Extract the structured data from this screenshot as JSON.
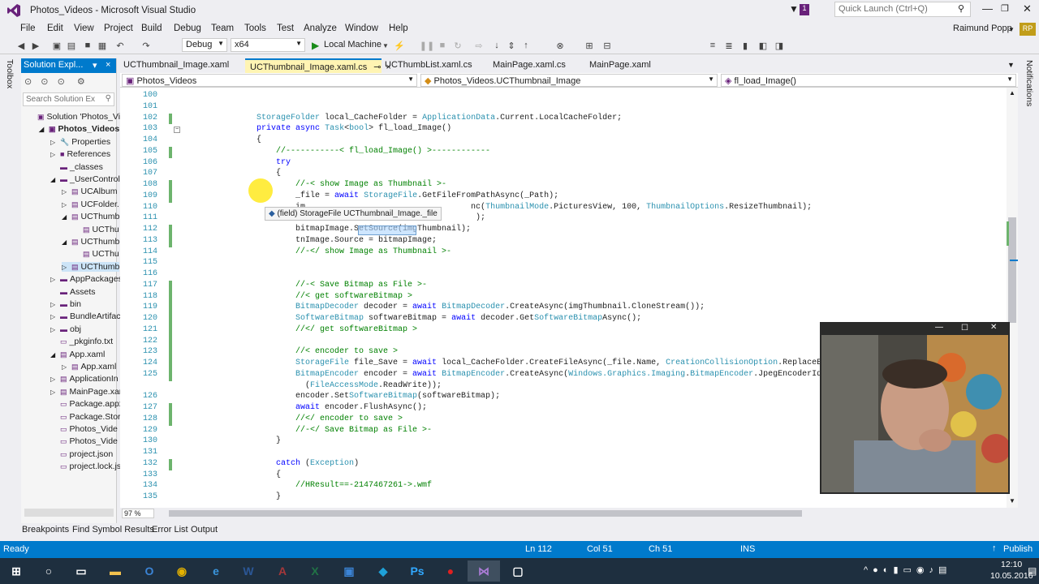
{
  "window": {
    "title": "Photos_Videos - Microsoft Visual Studio",
    "quick_launch": "Quick Launch (Ctrl+Q)",
    "user": "Raimund Popp",
    "user_initials": "RP",
    "notif_count": "1"
  },
  "menu": [
    "File",
    "Edit",
    "View",
    "Project",
    "Build",
    "Debug",
    "Team",
    "Tools",
    "Test",
    "Analyze",
    "Window",
    "Help"
  ],
  "toolbar": {
    "config": "Debug",
    "platform": "x64",
    "run_label": "Local Machine"
  },
  "solution_explorer": {
    "title": "Solution Expl...",
    "search_placeholder": "Search Solution Ex",
    "items": [
      "Solution 'Photos_Vid",
      "Photos_Videos",
      "Properties",
      "References",
      "_classes",
      "_UserControls",
      "UCAlbum",
      "UCFolder.",
      "UCThumb",
      "UCThu",
      "UCThumb",
      "UCThu",
      "UCThumb",
      "AppPackages",
      "Assets",
      "bin",
      "BundleArtifac",
      "obj",
      "_pkginfo.txt",
      "App.xaml",
      "App.xaml",
      "ApplicationIn",
      "MainPage.xar",
      "Package.appx",
      "Package.Store",
      "Photos_Vide",
      "Photos_Vide",
      "project.json",
      "project.lock.js"
    ],
    "zoom": "97 %"
  },
  "tabs": [
    "UCThumbnail_Image.xaml",
    "UCThumbnail_Image.xaml.cs",
    "UCThumbList.xaml.cs",
    "MainPage.xaml.cs",
    "MainPage.xaml"
  ],
  "navbar": {
    "project": "Photos_Videos",
    "class": "Photos_Videos.UCThumbnail_Image",
    "member": "fl_load_Image()"
  },
  "code_lines": [
    {
      "n": "100",
      "t": ""
    },
    {
      "n": "101",
      "t": ""
    },
    {
      "n": "102",
      "t": "        StorageFolder local_CacheFolder = ApplicationData.Current.LocalCacheFolder;"
    },
    {
      "n": "103",
      "t": "        private async Task<bool> fl_load_Image()"
    },
    {
      "n": "104",
      "t": "        {"
    },
    {
      "n": "105",
      "t": "            //-----------< fl_load_Image() >------------"
    },
    {
      "n": "106",
      "t": "            try"
    },
    {
      "n": "107",
      "t": "            {"
    },
    {
      "n": "108",
      "t": "                //-< show Image as Thumbnail >-"
    },
    {
      "n": "109",
      "t": "                _file = await StorageFile.GetFileFromPathAsync(_Path);"
    },
    {
      "n": "110",
      "t": "                im                                  nc(ThumbnailMode.PicturesView, 100, ThumbnailOptions.ResizeThumbnail);"
    },
    {
      "n": "111",
      "t": "                Bi                                   );"
    },
    {
      "n": "112",
      "t": "                bitmapImage.SetSource(imgThumbnail);"
    },
    {
      "n": "113",
      "t": "                tnImage.Source = bitmapImage;"
    },
    {
      "n": "114",
      "t": "                //-</ show Image as Thumbnail >-"
    },
    {
      "n": "115",
      "t": ""
    },
    {
      "n": "116",
      "t": ""
    },
    {
      "n": "117",
      "t": "                //-< Save Bitmap as File >-"
    },
    {
      "n": "118",
      "t": "                //< get softwareBitmap >"
    },
    {
      "n": "119",
      "t": "                BitmapDecoder decoder = await BitmapDecoder.CreateAsync(imgThumbnail.CloneStream());"
    },
    {
      "n": "120",
      "t": "                SoftwareBitmap softwareBitmap = await decoder.GetSoftwareBitmapAsync();"
    },
    {
      "n": "121",
      "t": "                //</ get softwareBitmap >"
    },
    {
      "n": "122",
      "t": ""
    },
    {
      "n": "123",
      "t": "                //< encoder to save >"
    },
    {
      "n": "124",
      "t": "                StorageFile file_Save = await local_CacheFolder.CreateFileAsync(_file.Name, CreationCollisionOption.ReplaceExisting);"
    },
    {
      "n": "125",
      "t": "                BitmapEncoder encoder = await BitmapEncoder.CreateAsync(Windows.Graphics.Imaging.BitmapEncoder.JpegEncoderId, await file"
    },
    {
      "n": "",
      "t": "                  (FileAccessMode.ReadWrite));"
    },
    {
      "n": "126",
      "t": "                encoder.SetSoftwareBitmap(softwareBitmap);"
    },
    {
      "n": "127",
      "t": "                await encoder.FlushAsync();"
    },
    {
      "n": "128",
      "t": "                //</ encoder to save >"
    },
    {
      "n": "129",
      "t": "                //-</ Save Bitmap as File >-"
    },
    {
      "n": "130",
      "t": "            }"
    },
    {
      "n": "131",
      "t": ""
    },
    {
      "n": "132",
      "t": "            catch (Exception)"
    },
    {
      "n": "133",
      "t": "            {"
    },
    {
      "n": "134",
      "t": "                //HResult==-2147467261->.wmf"
    },
    {
      "n": "135",
      "t": "            }"
    }
  ],
  "tooltip": "(field) StorageFile UCThumbnail_Image._file",
  "bottom_tabs": [
    "Breakpoints",
    "Find Symbol Results",
    "Error List",
    "Output"
  ],
  "status": {
    "left": "Ready",
    "ln": "Ln 112",
    "col": "Col 51",
    "ch": "Ch 51",
    "ins": "INS",
    "publish": "Publish"
  },
  "clock": {
    "time": "12:10",
    "date": "10.05.2016"
  },
  "side_labels": {
    "toolbox": "Toolbox",
    "notifications": "Notifications"
  },
  "colors": {
    "accent": "#007acc",
    "statusbar": "#007acc",
    "taskbar": "#1e2f3f",
    "vs_purple": "#68217a"
  }
}
